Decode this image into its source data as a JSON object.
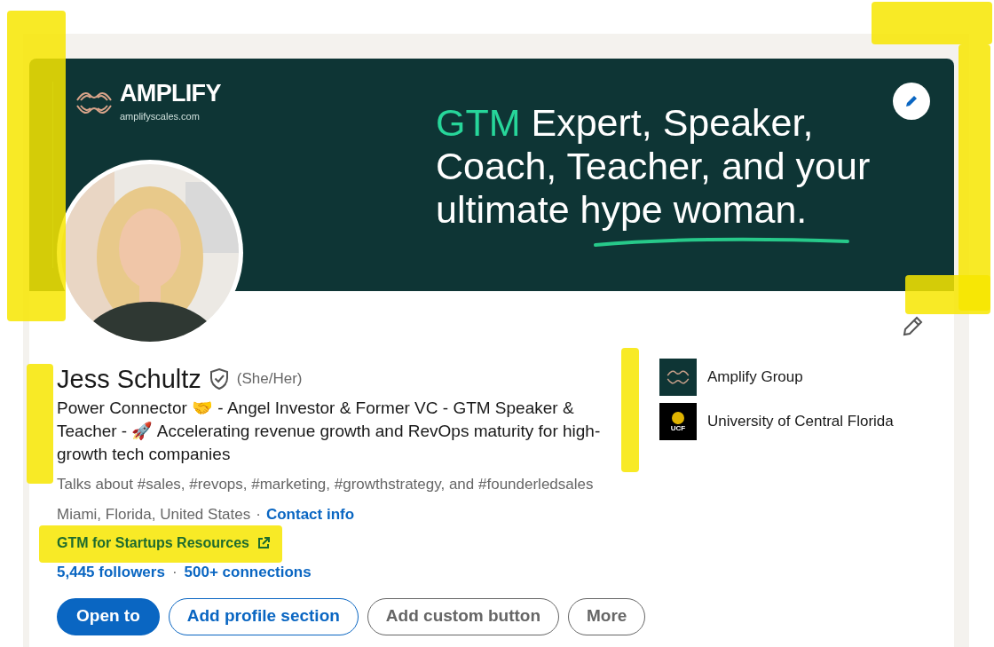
{
  "banner": {
    "logo_name": "AMPLIFY",
    "logo_url": "amplifyscales.com",
    "headline_accent": "GTM",
    "headline_lines": [
      " Expert, Speaker,",
      "Coach, Teacher, and your",
      "ultimate hype woman."
    ]
  },
  "profile": {
    "name": "Jess Schultz",
    "verified": true,
    "pronouns": "(She/Her)",
    "headline": "Power Connector 🤝  - Angel Investor & Former VC - GTM Speaker & Teacher - 🚀  Accelerating revenue growth and RevOps maturity for high-growth tech companies",
    "talks_about": "Talks about #sales, #revops, #marketing, #growthstrategy, and #founderledsales",
    "location": "Miami, Florida, United States",
    "separator": "·",
    "contact_link": "Contact info",
    "website": "GTM for Startups Resources",
    "followers": "5,445 followers",
    "connections": "500+ connections"
  },
  "affiliations": [
    {
      "kind": "company",
      "name": "Amplify Group"
    },
    {
      "kind": "school",
      "name": "University of Central Florida",
      "logo_text": "UCF"
    }
  ],
  "buttons": [
    {
      "label": "Open to",
      "kind": "primary"
    },
    {
      "label": "Add profile section",
      "kind": "outline-blue"
    },
    {
      "label": "Add custom button",
      "kind": "outline-gray"
    },
    {
      "label": "More",
      "kind": "outline-gray"
    }
  ]
}
